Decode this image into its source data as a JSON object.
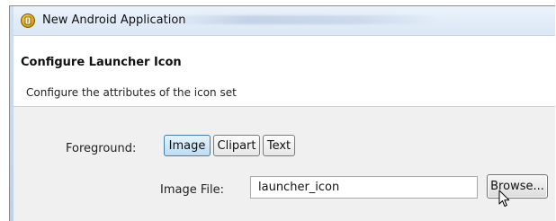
{
  "window": {
    "title": "New Android Application",
    "icon": "android-sdk-icon"
  },
  "header": {
    "title": "Configure Launcher Icon",
    "description": "Configure the attributes of the icon set"
  },
  "form": {
    "foreground_label": "Foreground:",
    "foreground_options": [
      {
        "label": "Image",
        "selected": true
      },
      {
        "label": "Clipart",
        "selected": false
      },
      {
        "label": "Text",
        "selected": false
      }
    ],
    "image_file_label": "Image File:",
    "image_file_value": "launcher_icon",
    "browse_label": "Browse..."
  },
  "colors": {
    "title_bar": "#dbe7f5",
    "selected_toggle": "#bddcf3",
    "body_bg": "#f0f0f0"
  }
}
